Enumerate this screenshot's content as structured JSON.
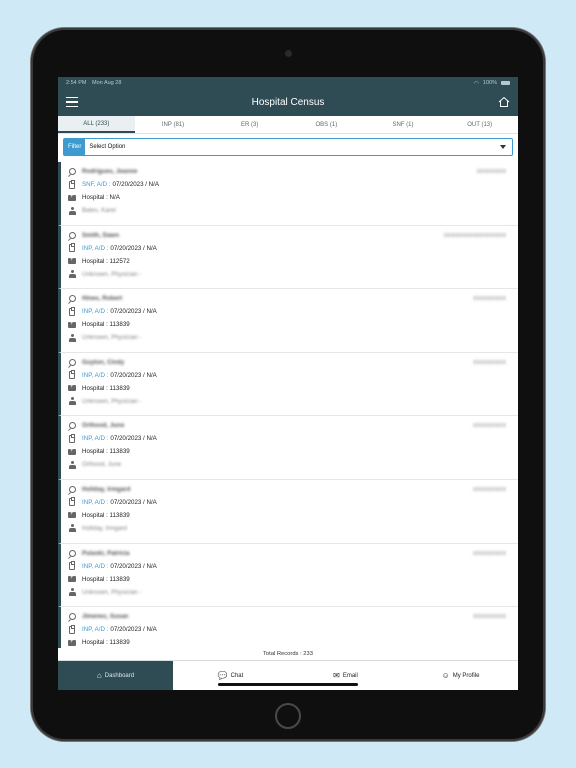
{
  "status_bar": {
    "time": "2:54 PM",
    "date": "Mon Aug 28",
    "battery": "100%"
  },
  "nav": {
    "title": "Hospital Census"
  },
  "tabs": [
    {
      "label": "ALL (233)",
      "active": true
    },
    {
      "label": "INP (81)"
    },
    {
      "label": "ER (3)"
    },
    {
      "label": "OBS (1)"
    },
    {
      "label": "SNF (1)"
    },
    {
      "label": "OUT (13)"
    }
  ],
  "filter": {
    "label": "Filter",
    "value": "Select Option"
  },
  "patients": [
    {
      "name": "Rodrigues, Jeanne",
      "mrn": "XXXXXXXX",
      "type": "SNF, A/D :",
      "dates": "07/20/2023 / N/A",
      "hospital": "Hospital : N/A",
      "physician": "Bates, Karel"
    },
    {
      "name": "Smith, Dawn",
      "mrn": "XXXXXXXXXXXXXXXXX",
      "type": "INP, A/D :",
      "dates": "07/20/2023 / N/A",
      "hospital": "Hospital : 112572",
      "physician": "Unknown, Physician -"
    },
    {
      "name": "Hines, Robert",
      "mrn": "XXXXXXXXX",
      "type": "INP, A/D :",
      "dates": "07/20/2023 / N/A",
      "hospital": "Hospital : 113839",
      "physician": "Unknown, Physician -"
    },
    {
      "name": "Guyton, Cindy",
      "mrn": "XXXXXXXXX",
      "type": "INP, A/D :",
      "dates": "07/20/2023 / N/A",
      "hospital": "Hospital : 113839",
      "physician": "Unknown, Physician -"
    },
    {
      "name": "Orthood, June",
      "mrn": "XXXXXXXXX",
      "type": "INP, A/D :",
      "dates": "07/20/2023 / N/A",
      "hospital": "Hospital : 113839",
      "physician": "Orthood, June"
    },
    {
      "name": "Holiday, Irmgard",
      "mrn": "XXXXXXXXX",
      "type": "INP, A/D :",
      "dates": "07/20/2023 / N/A",
      "hospital": "Hospital : 113839",
      "physician": "Holiday, Irmgard"
    },
    {
      "name": "Pulaski, Patricia",
      "mrn": "XXXXXXXXX",
      "type": "INP, A/D :",
      "dates": "07/20/2023 / N/A",
      "hospital": "Hospital : 113839",
      "physician": "Unknown, Physician -"
    },
    {
      "name": "Jimenez, Susan",
      "mrn": "XXXXXXXXX",
      "type": "INP, A/D :",
      "dates": "07/20/2023 / N/A",
      "hospital": "Hospital : 113839",
      "physician": "Unknown, Physician -"
    }
  ],
  "total": "Total Records : 233",
  "bottom_nav": [
    {
      "label": "Dashboard",
      "icon": "house-icon",
      "active": true
    },
    {
      "label": "Chat",
      "icon": "chat-icon"
    },
    {
      "label": "Email",
      "icon": "envelope-icon"
    },
    {
      "label": "My Profile",
      "icon": "profile-icon"
    }
  ],
  "colors": {
    "header": "#2f4c55",
    "accent": "#3e9bd0"
  }
}
